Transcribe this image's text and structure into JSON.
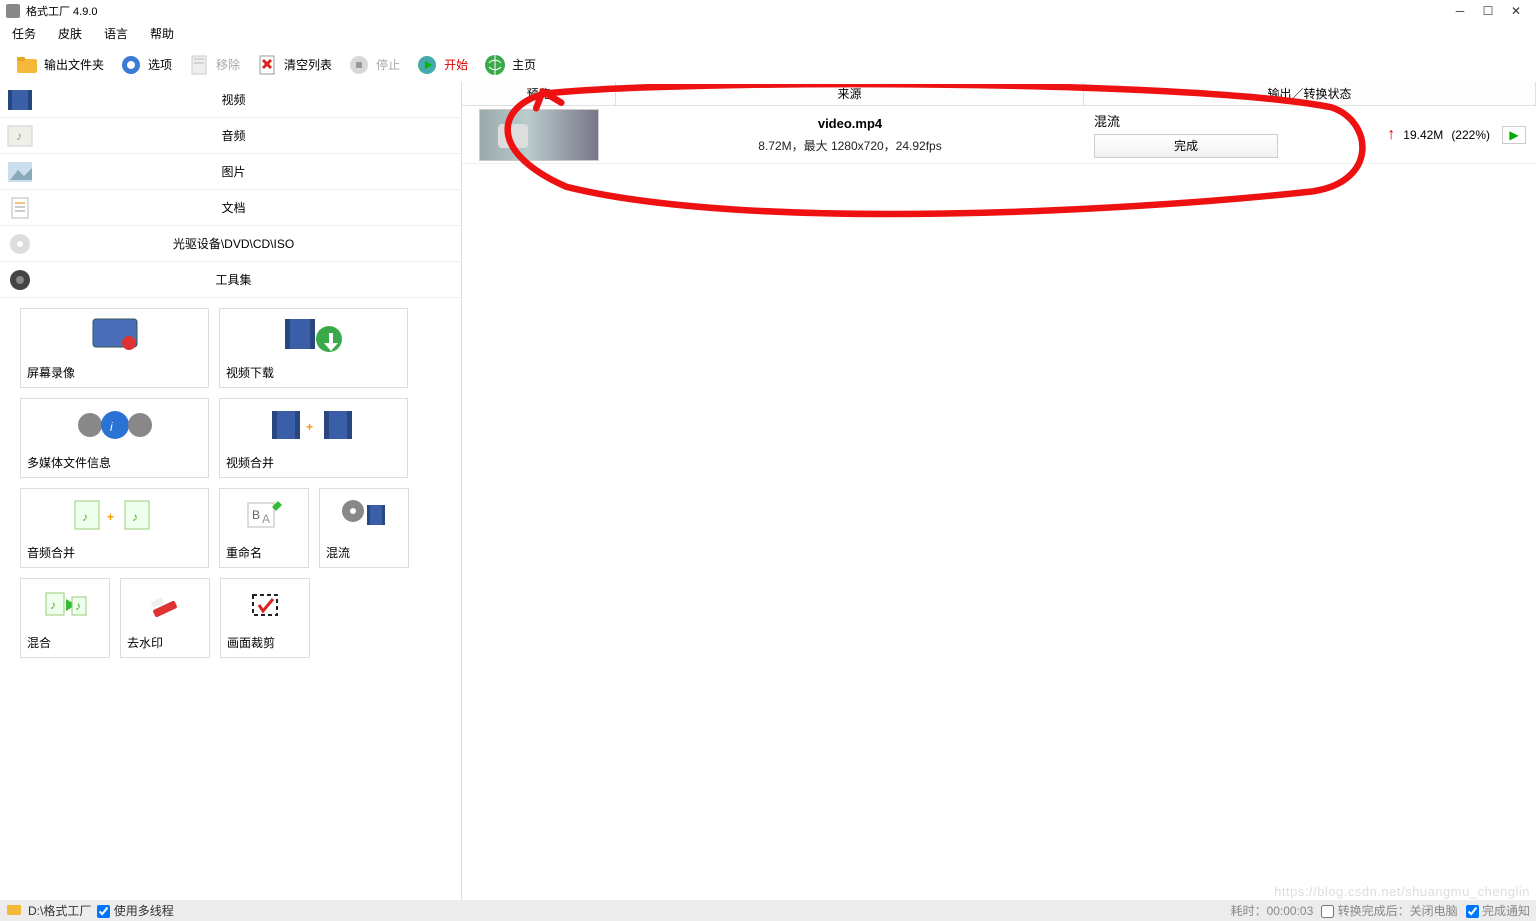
{
  "window": {
    "title": "格式工厂 4.9.0"
  },
  "menu": {
    "task": "任务",
    "skin": "皮肤",
    "language": "语言",
    "help": "帮助"
  },
  "toolbar": {
    "outputFolder": "输出文件夹",
    "options": "选项",
    "remove": "移除",
    "clearList": "清空列表",
    "stop": "停止",
    "start": "开始",
    "home": "主页"
  },
  "categories": {
    "video": "视频",
    "audio": "音频",
    "image": "图片",
    "document": "文档",
    "disc": "光驱设备\\DVD\\CD\\ISO",
    "toolset": "工具集"
  },
  "tools": {
    "screenRecord": "屏幕录像",
    "videoDownload": "视频下载",
    "mediaInfo": "多媒体文件信息",
    "videoMerge": "视频合并",
    "audioMerge": "音频合并",
    "rename": "重命名",
    "mux": "混流",
    "muxBlend": "混合",
    "removeWatermark": "去水印",
    "crop": "画面裁剪"
  },
  "listHeaders": {
    "preview": "预览",
    "source": "来源",
    "output": "输出／转换状态"
  },
  "row": {
    "filename": "video.mp4",
    "info": "8.72M，最大 1280x720，24.92fps",
    "mode": "混流",
    "status": "完成",
    "resultSize": "19.42M",
    "percent": "(222%)"
  },
  "status": {
    "path": "D:\\格式工厂",
    "multithread": "使用多线程",
    "elapsed": "耗时：00:00:03",
    "afterDone": "转换完成后：关闭电脑",
    "doneNotify": "完成通知"
  },
  "watermark": "https://blog.csdn.net/shuangmu_chenglin"
}
